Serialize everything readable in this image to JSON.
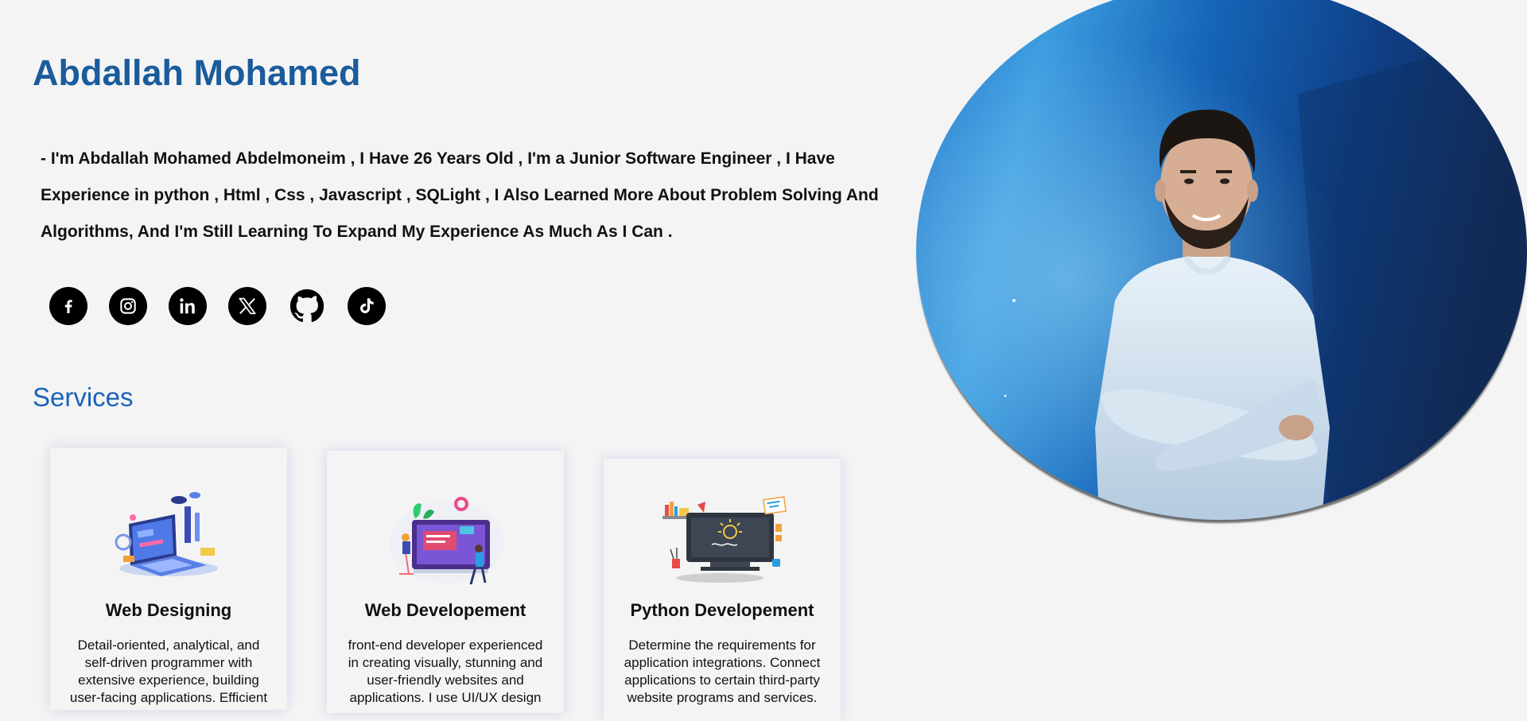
{
  "profile": {
    "name": "Abdallah Mohamed",
    "bio": "- I'm Abdallah Mohamed Abdelmoneim , I Have 26 Years Old , I'm a Junior Software Engineer , I Have Experience in python , Html , Css , Javascript , SQLight , I Also Learned More About Problem Solving And Algorithms, And I'm Still Learning To Expand My Experience As Much As I Can ."
  },
  "social_links": [
    {
      "icon": "facebook-icon"
    },
    {
      "icon": "instagram-icon"
    },
    {
      "icon": "linkedin-icon"
    },
    {
      "icon": "x-icon"
    },
    {
      "icon": "github-icon"
    },
    {
      "icon": "tiktok-icon"
    }
  ],
  "services": {
    "title": "Services",
    "cards": [
      {
        "title": "Web Designing",
        "description": "Detail-oriented, analytical, and self-driven programmer with extensive experience, building user-facing applications. Efficient",
        "illustration": "laptop-design-illustration"
      },
      {
        "title": "Web Developement",
        "description": "front-end developer experienced in creating visually, stunning and user-friendly websites and applications. I use UI/UX design",
        "illustration": "web-dev-illustration"
      },
      {
        "title": "Python Developement",
        "description": "Determine the requirements for application integrations. Connect applications to certain third-party website programs and services.",
        "illustration": "python-monitor-illustration"
      }
    ]
  },
  "colors": {
    "name": "#1a5c9b",
    "services_title": "#1a63b8",
    "background": "#f4f4f4"
  }
}
